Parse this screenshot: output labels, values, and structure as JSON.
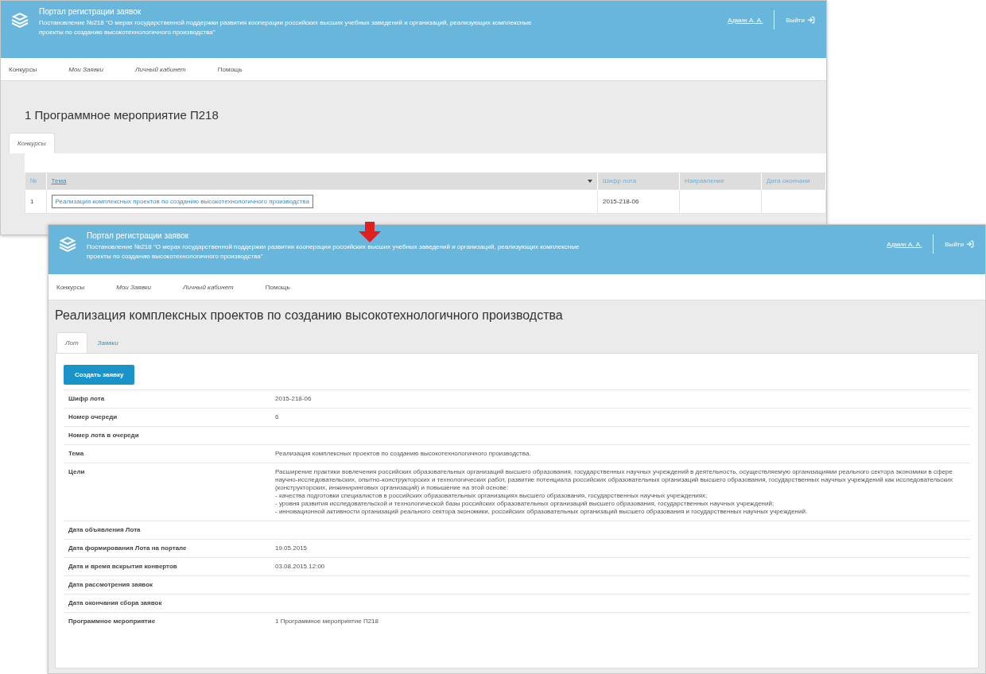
{
  "windows": [
    {
      "kind": "list",
      "portal": "Портал регистрации заявок",
      "decree": "Постановление №218 \"О мерах государственной поддержки развития кооперации российских высших учебных заведений и организаций, реализующих комплексные проекты по созданию высокотехнологичного производства\"",
      "user": "Админ А. А.",
      "logout": "Выйти",
      "nav": [
        "Конкурсы",
        "Мои Заявки",
        "Личный кабинет",
        "Помощь"
      ],
      "heading": "1 Программное мероприятие П218",
      "tabs": [
        {
          "label": "Конкурсы",
          "selected": true
        }
      ],
      "columns": [
        "№",
        "Тема",
        "Шифр лота",
        "Направление",
        "Дата окончани"
      ],
      "rows": [
        {
          "cells": [
            "1",
            "Реализация комплексных проектов по созданию высокотехнологичного производства",
            "2015-218-06",
            "",
            ""
          ],
          "highlighted": true
        }
      ]
    },
    {
      "kind": "detail",
      "portal": "Портал регистрации заявок",
      "decree": "Постановление №218 \"О мерах государственной поддержки развития кооперации российских высших учебных заведений и организаций, реализующих комплексные проекты по созданию высокотехнологичного производства\"",
      "user": "Админ А. А.",
      "logout": "Выйти",
      "nav": [
        "Конкурсы",
        "Мои Заявки",
        "Личный кабинет",
        "Помощь"
      ],
      "heading": "Реализация комплексных проектов по созданию высокотехнологичного производства",
      "tabs": [
        {
          "label": "Лот",
          "selected": true
        },
        {
          "label": "Заявки",
          "selected": false
        }
      ],
      "button": "Создать заявку",
      "fields": [
        {
          "label": "Шифр лота",
          "value": [
            "2015-218-06"
          ]
        },
        {
          "label": "Номер очереди",
          "value": [
            "6"
          ]
        },
        {
          "label": "Номер лота в очереди"
        },
        {
          "label": "Тема",
          "value": [
            "Реализация комплексных проектов по созданию высокотехнологичного производства."
          ]
        },
        {
          "label": "Цели",
          "value": [
            "Расширение практики вовлечения российских образовательных организаций высшего образования, государственных научных учреждений в деятельность, осуществляемую организациями реального сектора экономики в сфере научно-исследовательских, опытно-конструкторских и технологических работ, развитие потенциала российских образовательных организаций высшего образования, государственных научных учреждений как исследовательских (конструкторских, инжиниринговых организаций) и повышение на этой основе:",
            "- качества подготовки специалистов в российских образовательных организациях высшего образования, государственных научных учреждениях;",
            "- уровня развития исследовательской и технологической базы российских образовательных организаций высшего образования, государственных научных учреждений;",
            "- инновационной активности организаций реального сектора экономики, российских образовательных организаций высшего образования и государственных научных учреждений."
          ]
        },
        {
          "label": "Дата объявления Лота"
        },
        {
          "label": "Дата формирования Лота на портале",
          "value": [
            "19.05.2015"
          ]
        },
        {
          "label": "Дата и время вскрытия конвертов",
          "value": [
            "03.08.2015 12:00"
          ]
        },
        {
          "label": "Дата рассмотрения заявок"
        },
        {
          "label": "Дата окончания сбора заявок"
        },
        {
          "label": "Программное мероприятие",
          "value": [
            "1 Программное мероприятие П218"
          ]
        }
      ]
    }
  ]
}
